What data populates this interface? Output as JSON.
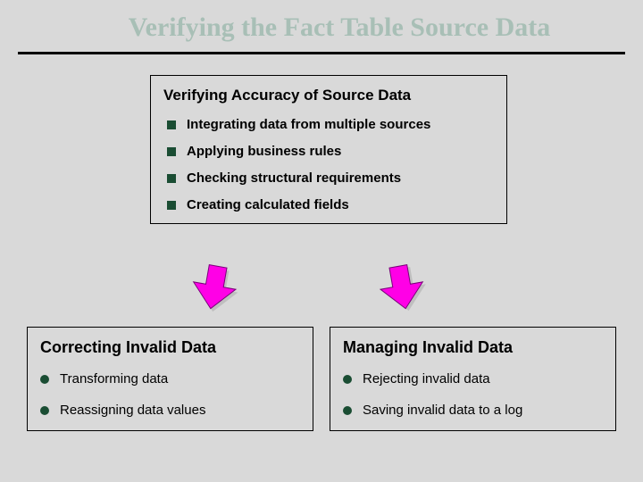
{
  "title": "Verifying the Fact Table Source Data",
  "topBox": {
    "heading": "Verifying Accuracy of Source Data",
    "items": [
      "Integrating data from multiple sources",
      "Applying business rules",
      "Checking structural requirements",
      "Creating calculated fields"
    ]
  },
  "columns": [
    {
      "heading": "Correcting Invalid Data",
      "items": [
        "Transforming data",
        "Reassigning data values"
      ]
    },
    {
      "heading": "Managing Invalid Data",
      "items": [
        "Rejecting invalid data",
        "Saving invalid data to a log"
      ]
    }
  ],
  "colors": {
    "arrow": "#ff00e6",
    "arrowStroke": "#bfbfbf",
    "bullet": "#1a4d33"
  }
}
